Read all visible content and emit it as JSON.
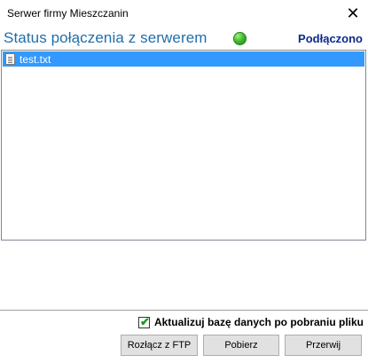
{
  "window": {
    "title": "Serwer firmy Mieszczanin",
    "close_glyph": "✕"
  },
  "status": {
    "label": "Status połączenia z serwerem",
    "indicator_color": "#3fb72a",
    "value": "Podłączono"
  },
  "files": {
    "items": [
      {
        "name": "test.txt",
        "icon": "text-file-icon",
        "selected": true
      }
    ]
  },
  "options": {
    "update_db_checked": true,
    "update_db_label": "Aktualizuj bazę danych po pobraniu pliku"
  },
  "buttons": {
    "disconnect": "Rozłącz z FTP",
    "download": "Pobierz",
    "abort": "Przerwij"
  }
}
